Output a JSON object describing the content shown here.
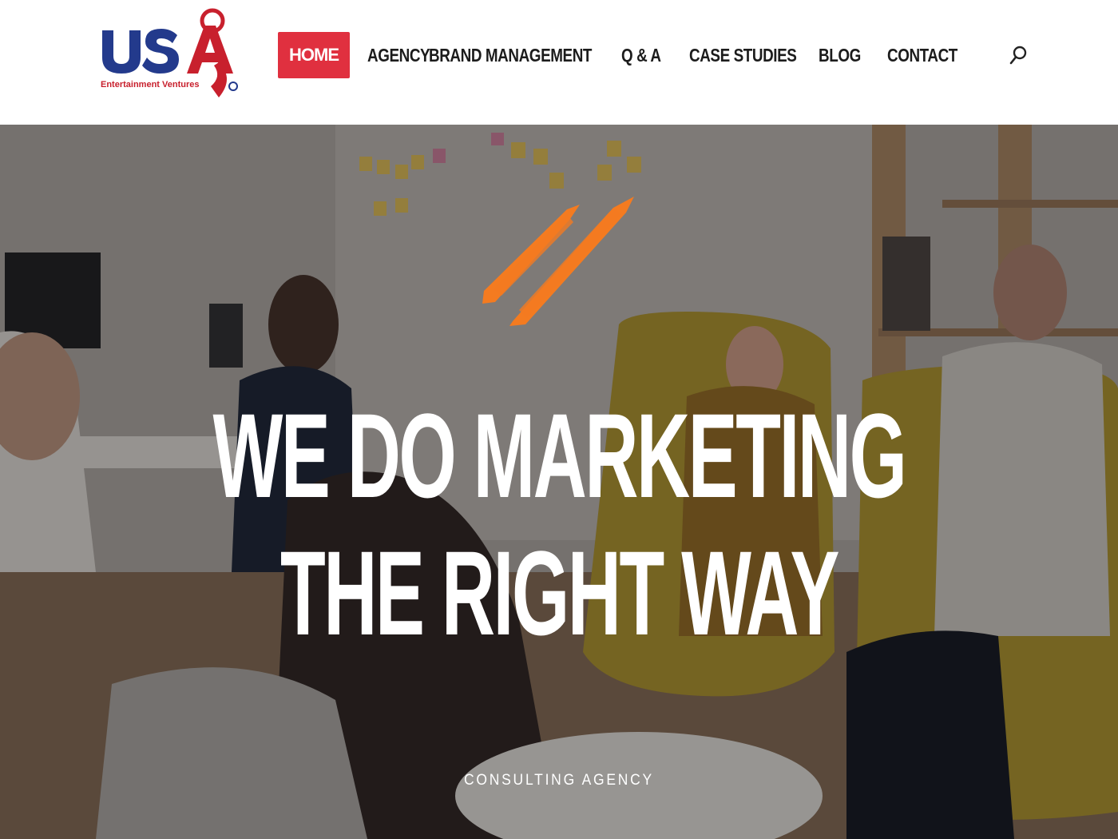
{
  "brand": {
    "logo_letters": "USA",
    "logo_tagline": "Entertainment Ventures",
    "colors": {
      "navy": "#233a8c",
      "red": "#c8202d"
    }
  },
  "nav": {
    "items": [
      {
        "label": "HOME",
        "active": true
      },
      {
        "label": "AGENCY",
        "active": false
      },
      {
        "label": "BRAND MANAGEMENT",
        "active": false
      },
      {
        "label": "Q & A",
        "active": false
      },
      {
        "label": "CASE STUDIES",
        "active": false
      },
      {
        "label": "BLOG",
        "active": false
      },
      {
        "label": "CONTACT",
        "active": false
      }
    ],
    "active_color": "#e0303f",
    "search_icon": "search-icon"
  },
  "hero": {
    "headline_line1": "WE DO MARKETING",
    "headline_line2": "THE RIGHT WAY",
    "subheading": "CONSULTING AGENCY",
    "accent_color": "#f47b20",
    "decoration_icon": "brush-stroke-icon"
  }
}
